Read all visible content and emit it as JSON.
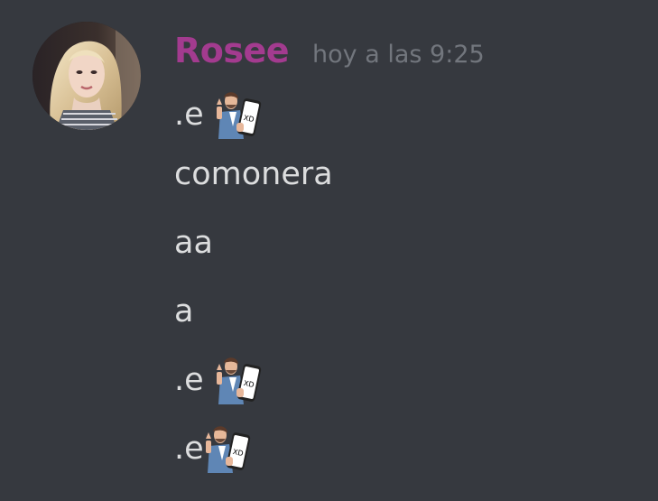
{
  "message_group": {
    "author": {
      "username": "Rosee",
      "username_color": "#a33b8f",
      "avatar_icon": "user-avatar"
    },
    "timestamp": "hoy a las 9:25",
    "messages": [
      {
        "text": ".e",
        "emoji": "xd-phone-guy-emoji",
        "emoji_text": "XD"
      },
      {
        "text": "comonera"
      },
      {
        "text": "aa"
      },
      {
        "text": "a"
      },
      {
        "text": ".e",
        "emoji": "xd-phone-guy-emoji",
        "emoji_text": "XD"
      },
      {
        "text": ".e",
        "emoji": "xd-phone-guy-emoji",
        "emoji_text": "XD"
      }
    ]
  },
  "colors": {
    "background": "#36393f",
    "message_text": "#dcddde",
    "timestamp": "#72767d"
  }
}
